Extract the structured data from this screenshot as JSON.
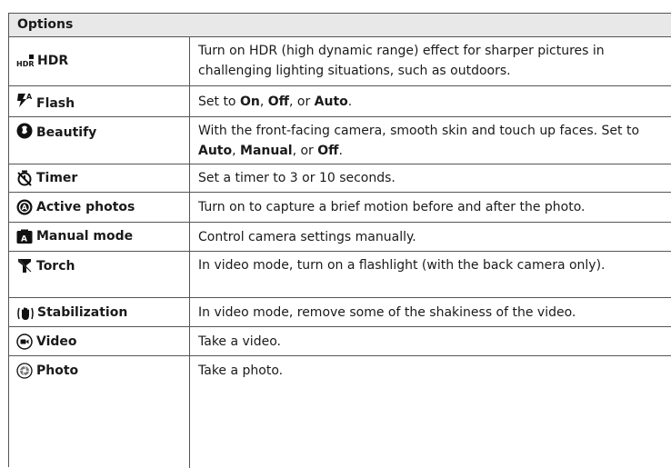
{
  "table": {
    "header": "Options",
    "rows": [
      {
        "icon": "hdr-icon",
        "label": "HDR",
        "desc": [
          "Turn on HDR (high dynamic range) effect for sharper pictures in challenging lighting situations, such as outdoors."
        ]
      },
      {
        "icon": "flash-auto-icon",
        "label": "Flash",
        "desc": [
          "Set to ",
          "On",
          ", ",
          "Off",
          ", or ",
          "Auto",
          "."
        ]
      },
      {
        "icon": "beautify-icon",
        "label": "Beautify",
        "desc": [
          "With the front-facing camera, smooth skin and touch up faces. Set to ",
          "Auto",
          ", ",
          "Manual",
          ", or ",
          "Off",
          "."
        ]
      },
      {
        "icon": "timer-icon",
        "label": "Timer",
        "desc": [
          "Set a timer to 3 or 10 seconds."
        ]
      },
      {
        "icon": "active-photos-icon",
        "label": "Active photos",
        "desc": [
          "Turn on to capture a brief motion before and after the photo."
        ]
      },
      {
        "icon": "manual-mode-icon",
        "label": "Manual mode",
        "desc": [
          "Control camera settings manually."
        ]
      },
      {
        "icon": "torch-icon",
        "label": "Torch",
        "desc": [
          "In video mode, turn on a flashlight (with the back camera only)."
        ]
      },
      {
        "icon": "stabilization-icon",
        "label": "Stabilization",
        "desc": [
          "In video mode, remove some of the shakiness of the video."
        ]
      },
      {
        "icon": "video-icon",
        "label": "Video",
        "desc": [
          "Take a video."
        ]
      },
      {
        "icon": "photo-icon",
        "label": "Photo",
        "desc": [
          "Take a photo."
        ]
      }
    ]
  }
}
